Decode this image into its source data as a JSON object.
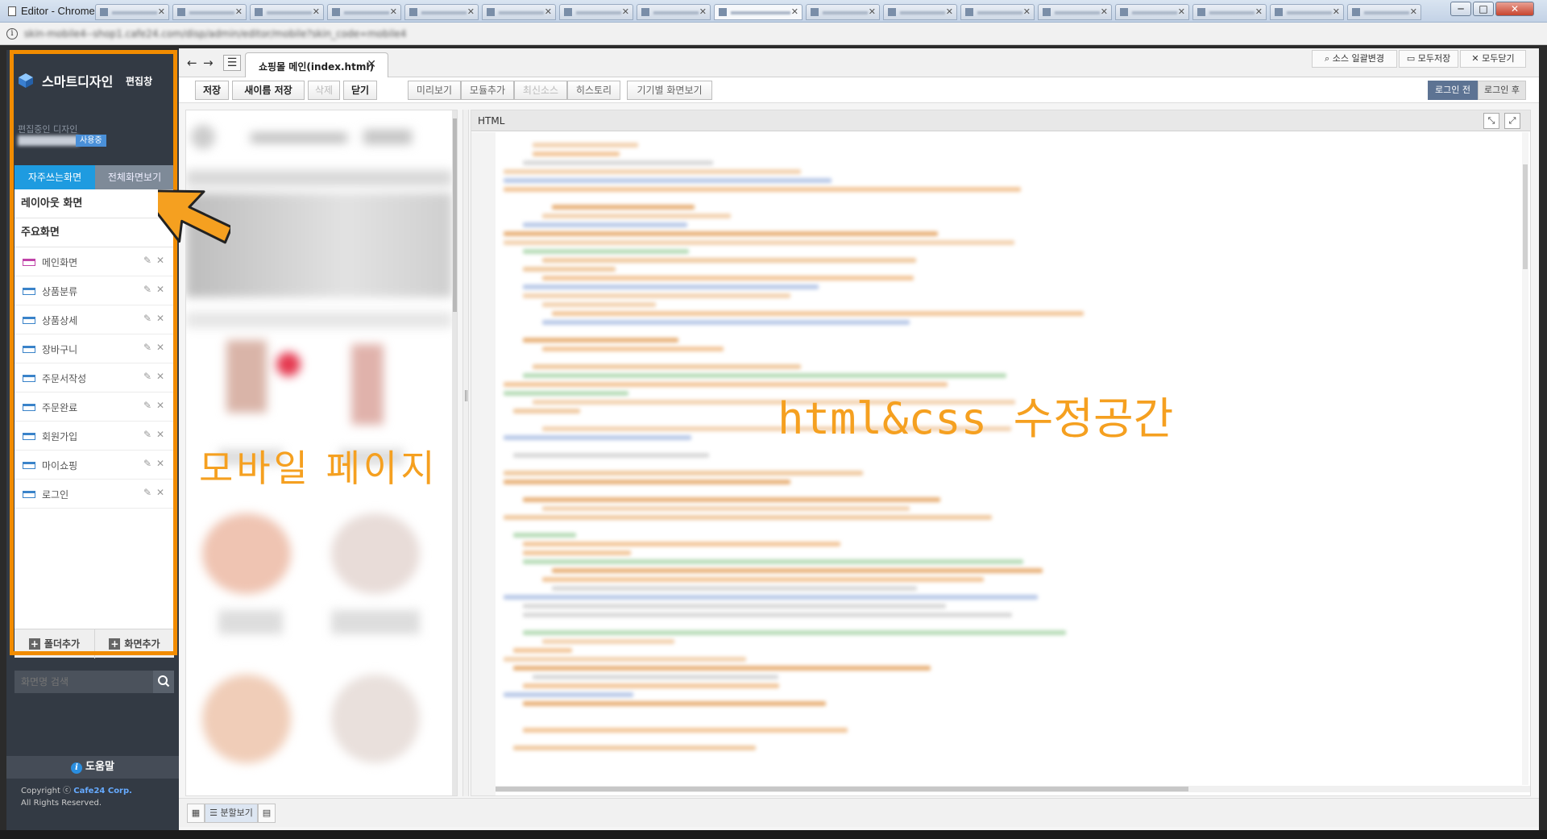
{
  "window": {
    "title": "Editor - Chrome",
    "controls": {
      "minimize": "─",
      "maximize": "□",
      "close": "✕"
    }
  },
  "addressbar": {
    "info_icon": "info-icon",
    "url": "skin-mobile4--shop1.cafe24.com/disp/admin/editor/mobile?skin_code=mobile4"
  },
  "sidebar": {
    "title": "스마트디자인",
    "subtitle": "편집창",
    "editing_label": "편집중인 디자인",
    "editing_badge": "사용중",
    "tabs": {
      "frequent": "자주쓰는화면",
      "all": "전체화면보기"
    },
    "sections": {
      "layout": "레이아웃 화면",
      "main": "주요화면"
    },
    "items": [
      {
        "label": "메인화면"
      },
      {
        "label": "상품분류"
      },
      {
        "label": "상품상세"
      },
      {
        "label": "장바구니"
      },
      {
        "label": "주문서작성"
      },
      {
        "label": "주문완료"
      },
      {
        "label": "회원가입"
      },
      {
        "label": "마이쇼핑"
      },
      {
        "label": "로그인"
      }
    ],
    "edit_glyph": "✎",
    "delete_glyph": "✕",
    "footer": {
      "add_folder": "폴더추가",
      "add_screen": "화면추가"
    },
    "search": {
      "placeholder": "화면명 검색"
    },
    "help": "도움말",
    "copyright_prefix": "Copyright ⓒ",
    "copyright_brand": "Cafe24 Corp.",
    "copyright_line2": "All Rights Reserved."
  },
  "main": {
    "nav": {
      "back": "←",
      "forward": "→"
    },
    "tab": {
      "label": "쇼핑몰 메인(index.html)",
      "close": "✕"
    },
    "top_buttons": {
      "source_batch": "소스 일괄변경",
      "save_all": "모두저장",
      "close_all": "모두닫기"
    },
    "toolbar": {
      "save": "저장",
      "save_as": "새이름 저장",
      "delete": "삭제",
      "close": "닫기",
      "preview": "미리보기",
      "add_module": "모듈추가",
      "latest_source": "최신소스",
      "history": "히스토리",
      "device_view": "기기별 화면보기",
      "login_before": "로그인 전",
      "login_after": "로그인 후"
    },
    "code_header": "HTML",
    "overlays": {
      "mobile": "모바일 페이지",
      "code": "html&css 수정공간"
    },
    "bottom": {
      "split_view": "분할보기"
    }
  },
  "colors": {
    "accent_orange": "#f28c00",
    "tab_active": "#1e9be0",
    "sidebar_bg": "#333a44",
    "login_active": "#5d7393"
  }
}
